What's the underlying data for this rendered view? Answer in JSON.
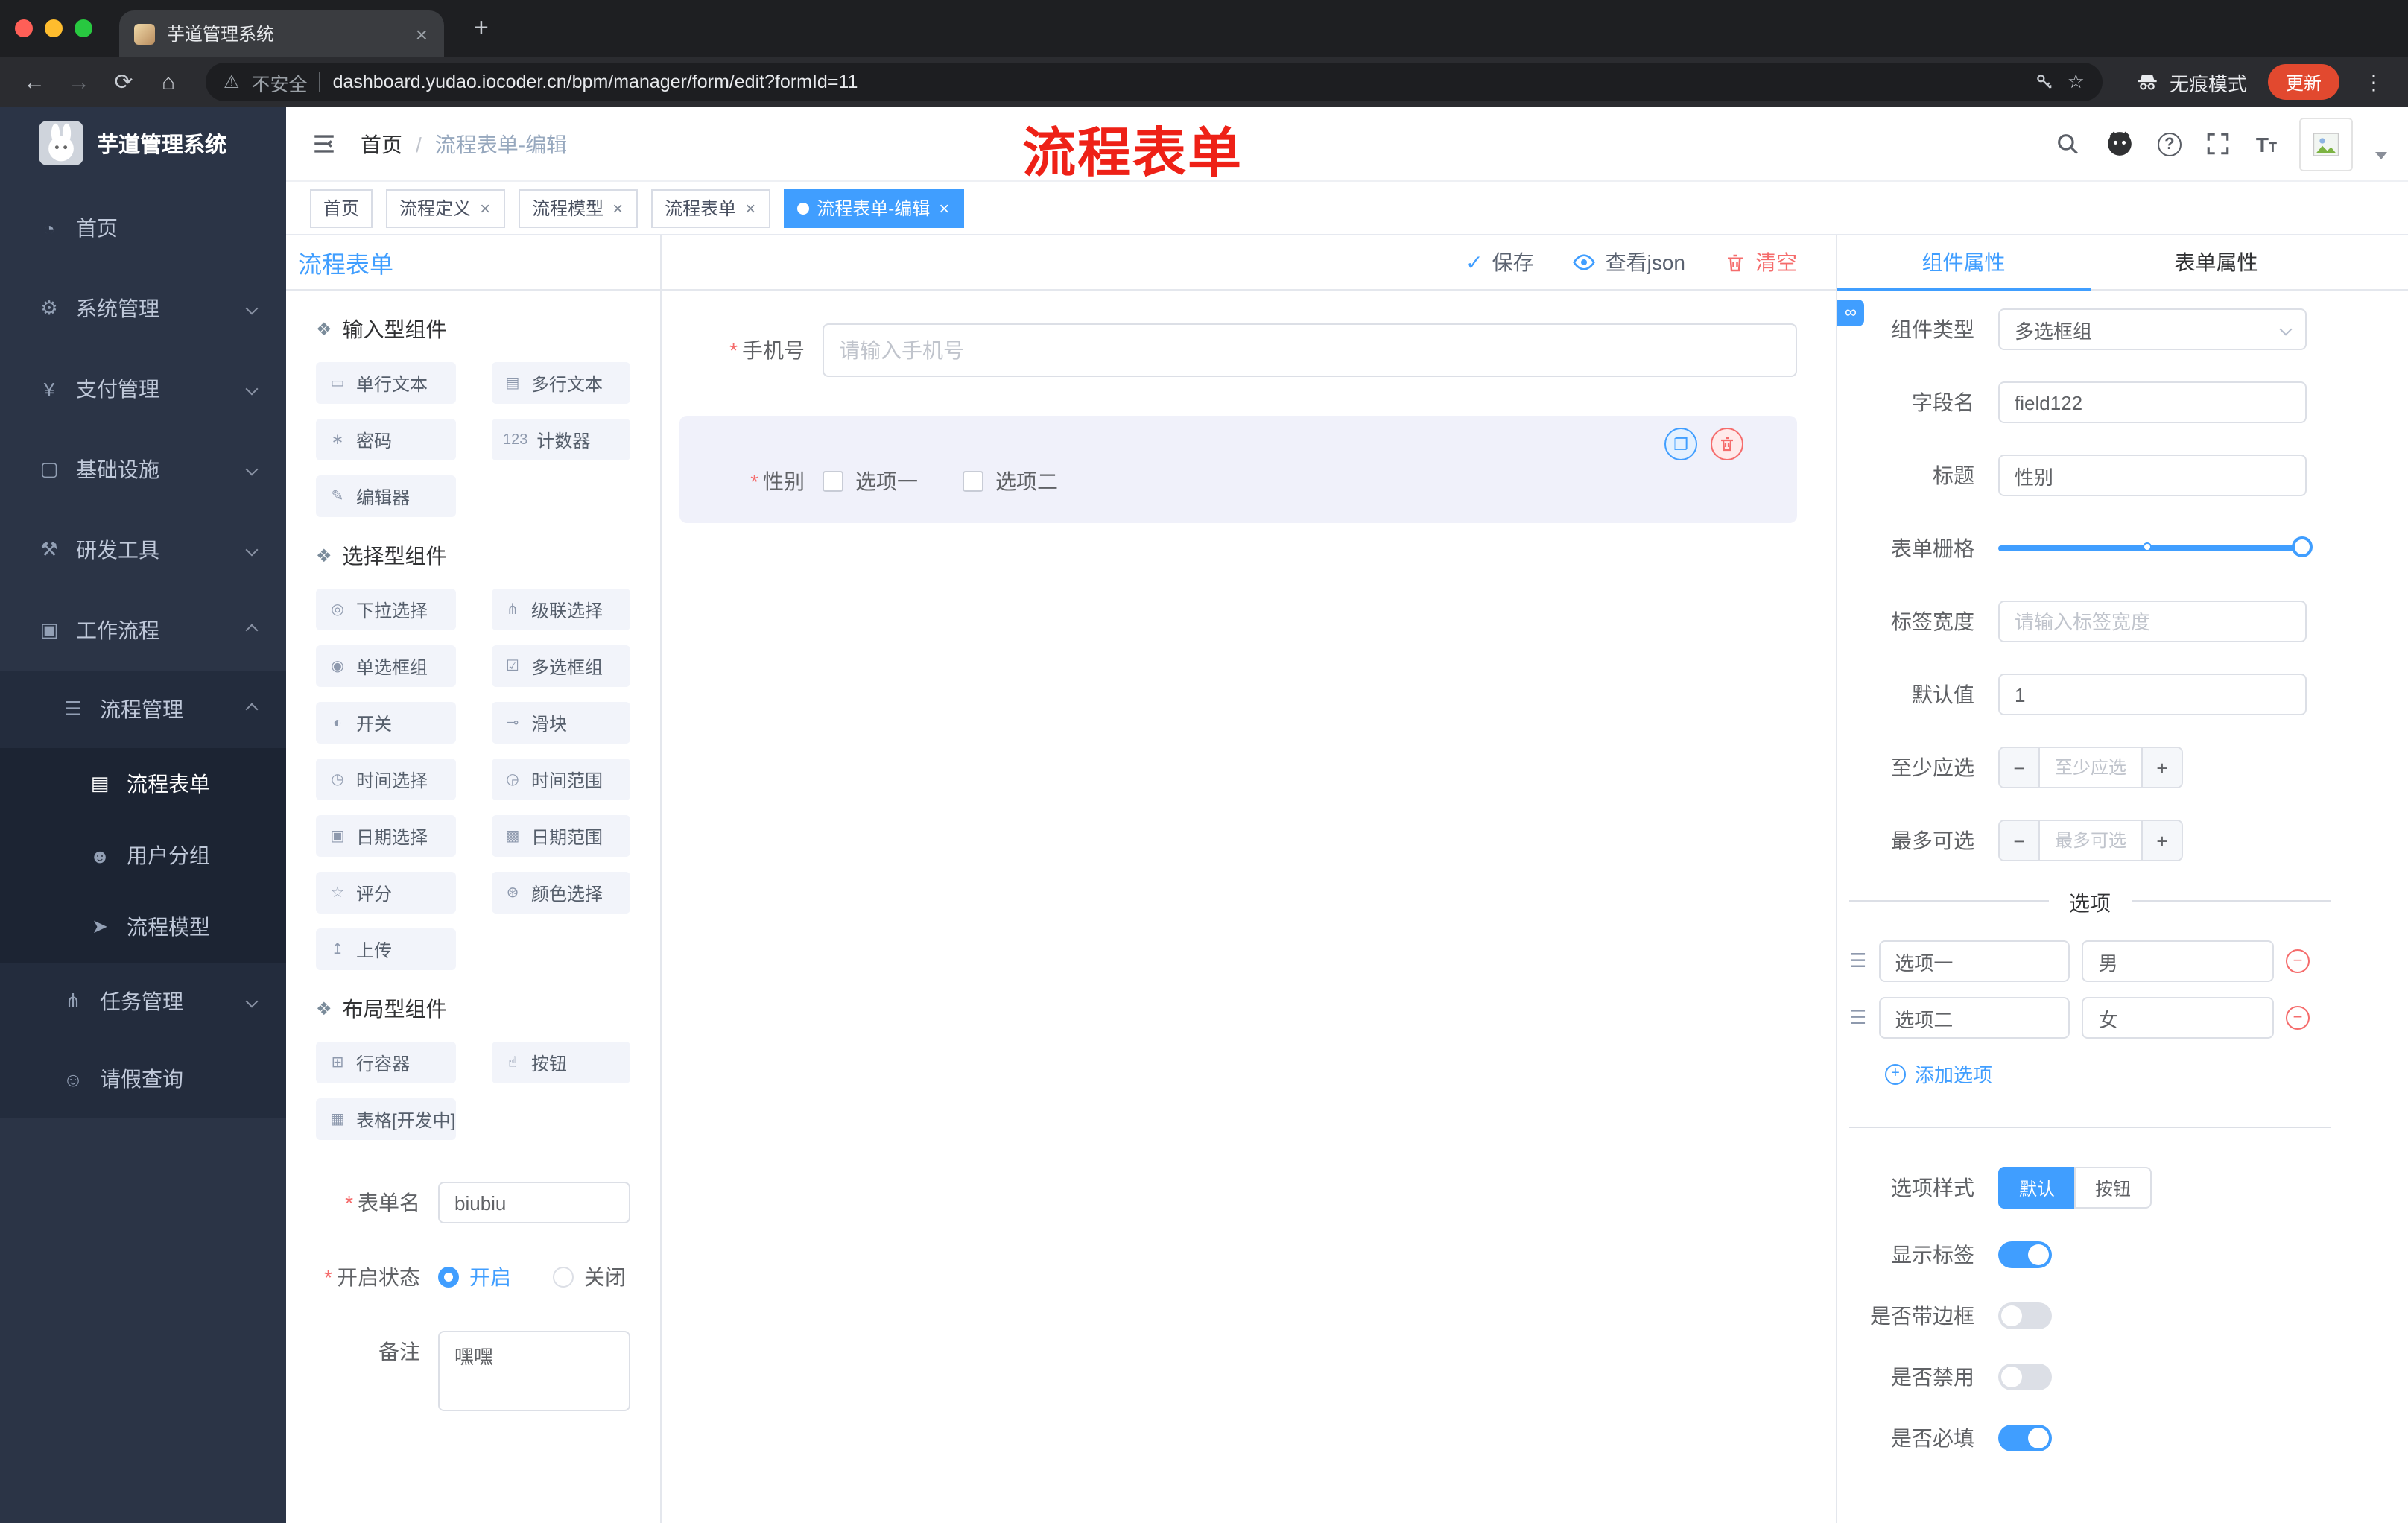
{
  "browser": {
    "tab_title": "芋道管理系统",
    "security": "不安全",
    "url": "dashboard.yudao.iocoder.cn/bpm/manager/form/edit?formId=11",
    "incognito": "无痕模式",
    "update": "更新"
  },
  "sidebar": {
    "logo": "芋道管理系统",
    "menu": [
      {
        "label": "首页",
        "glyph": "◔"
      },
      {
        "label": "系统管理",
        "glyph": "⚙"
      },
      {
        "label": "支付管理",
        "glyph": "¥"
      },
      {
        "label": "基础设施",
        "glyph": "▢"
      },
      {
        "label": "研发工具",
        "glyph": "⚒"
      },
      {
        "label": "工作流程",
        "glyph": "▣"
      }
    ],
    "process_group": {
      "label": "流程管理",
      "glyph": "☰"
    },
    "process_items": [
      {
        "label": "流程表单",
        "glyph": "▤"
      },
      {
        "label": "用户分组",
        "glyph": "☻"
      },
      {
        "label": "流程模型",
        "glyph": "➤"
      }
    ],
    "task": {
      "label": "任务管理",
      "glyph": "⋔"
    },
    "leave": {
      "label": "请假查询",
      "glyph": "☺"
    }
  },
  "header": {
    "breadcrumb_home": "首页",
    "breadcrumb_sep": "/",
    "breadcrumb_current": "流程表单-编辑",
    "annotation": "流程表单"
  },
  "tags": [
    {
      "label": "首页"
    },
    {
      "label": "流程定义"
    },
    {
      "label": "流程模型"
    },
    {
      "label": "流程表单"
    },
    {
      "label": "流程表单-编辑"
    }
  ],
  "designer": {
    "title": "流程表单",
    "groups": [
      {
        "title": "输入型组件",
        "glyph": "❖",
        "items": [
          {
            "label": "单行文本",
            "glyph": "▭"
          },
          {
            "label": "多行文本",
            "glyph": "▤"
          },
          {
            "label": "密码",
            "glyph": "∗"
          },
          {
            "label": "计数器",
            "glyph": "123"
          },
          {
            "label": "编辑器",
            "glyph": "✎"
          }
        ]
      },
      {
        "title": "选择型组件",
        "glyph": "❖",
        "items": [
          {
            "label": "下拉选择",
            "glyph": "◎"
          },
          {
            "label": "级联选择",
            "glyph": "⋔"
          },
          {
            "label": "单选框组",
            "glyph": "◉"
          },
          {
            "label": "多选框组",
            "glyph": "☑"
          },
          {
            "label": "开关",
            "glyph": "◐"
          },
          {
            "label": "滑块",
            "glyph": "⊸"
          },
          {
            "label": "时间选择",
            "glyph": "◷"
          },
          {
            "label": "时间范围",
            "glyph": "◶"
          },
          {
            "label": "日期选择",
            "glyph": "▣"
          },
          {
            "label": "日期范围",
            "glyph": "▩"
          },
          {
            "label": "评分",
            "glyph": "☆"
          },
          {
            "label": "颜色选择",
            "glyph": "⊛"
          },
          {
            "label": "上传",
            "glyph": "↥"
          }
        ]
      },
      {
        "title": "布局型组件",
        "glyph": "❖",
        "items": [
          {
            "label": "行容器",
            "glyph": "⊞"
          },
          {
            "label": "按钮",
            "glyph": "☝"
          },
          {
            "label": "表格[开发中]",
            "glyph": "▦"
          }
        ]
      }
    ],
    "form": {
      "name_label": "表单名",
      "name_value": "biubiu",
      "status_label": "开启状态",
      "status_on": "开启",
      "status_off": "关闭",
      "remark_label": "备注",
      "remark_value": "嘿嘿"
    }
  },
  "toolbar": {
    "save": "保存",
    "view_json": "查看json",
    "clear": "清空"
  },
  "canvas": {
    "phone": {
      "label": "手机号",
      "placeholder": "请输入手机号"
    },
    "gender": {
      "label": "性别",
      "option1": "选项一",
      "option2": "选项二"
    }
  },
  "props": {
    "tab_component": "组件属性",
    "tab_form": "表单属性",
    "component_type": {
      "label": "组件类型",
      "value": "多选框组"
    },
    "field_name": {
      "label": "字段名",
      "value": "field122"
    },
    "title": {
      "label": "标题",
      "value": "性别"
    },
    "grid_label": "表单栅格",
    "label_width": {
      "label": "标签宽度",
      "placeholder": "请输入标签宽度"
    },
    "default_value": {
      "label": "默认值",
      "value": "1"
    },
    "min_select": {
      "label": "至少应选",
      "placeholder": "至少应选"
    },
    "max_select": {
      "label": "最多可选",
      "placeholder": "最多可选"
    },
    "options_title": "选项",
    "options": [
      {
        "label": "选项一",
        "value": "男"
      },
      {
        "label": "选项二",
        "value": "女"
      }
    ],
    "add_option": "添加选项",
    "style_label": "选项样式",
    "style_default": "默认",
    "style_button": "按钮",
    "toggle_show_label": "显示标签",
    "toggle_border": "是否带边框",
    "toggle_disabled": "是否禁用",
    "toggle_required": "是否必填"
  },
  "icons": {
    "close": "×",
    "plus": "+",
    "back": "←",
    "forward": "→",
    "reload": "⟳",
    "home": "⌂",
    "warning": "⚠",
    "star": "☆",
    "dots": "⋮",
    "check": "✓",
    "minus": "−",
    "link": "∞",
    "copy": "❐",
    "drag": "☰",
    "req": "*",
    "qmark": "?"
  }
}
